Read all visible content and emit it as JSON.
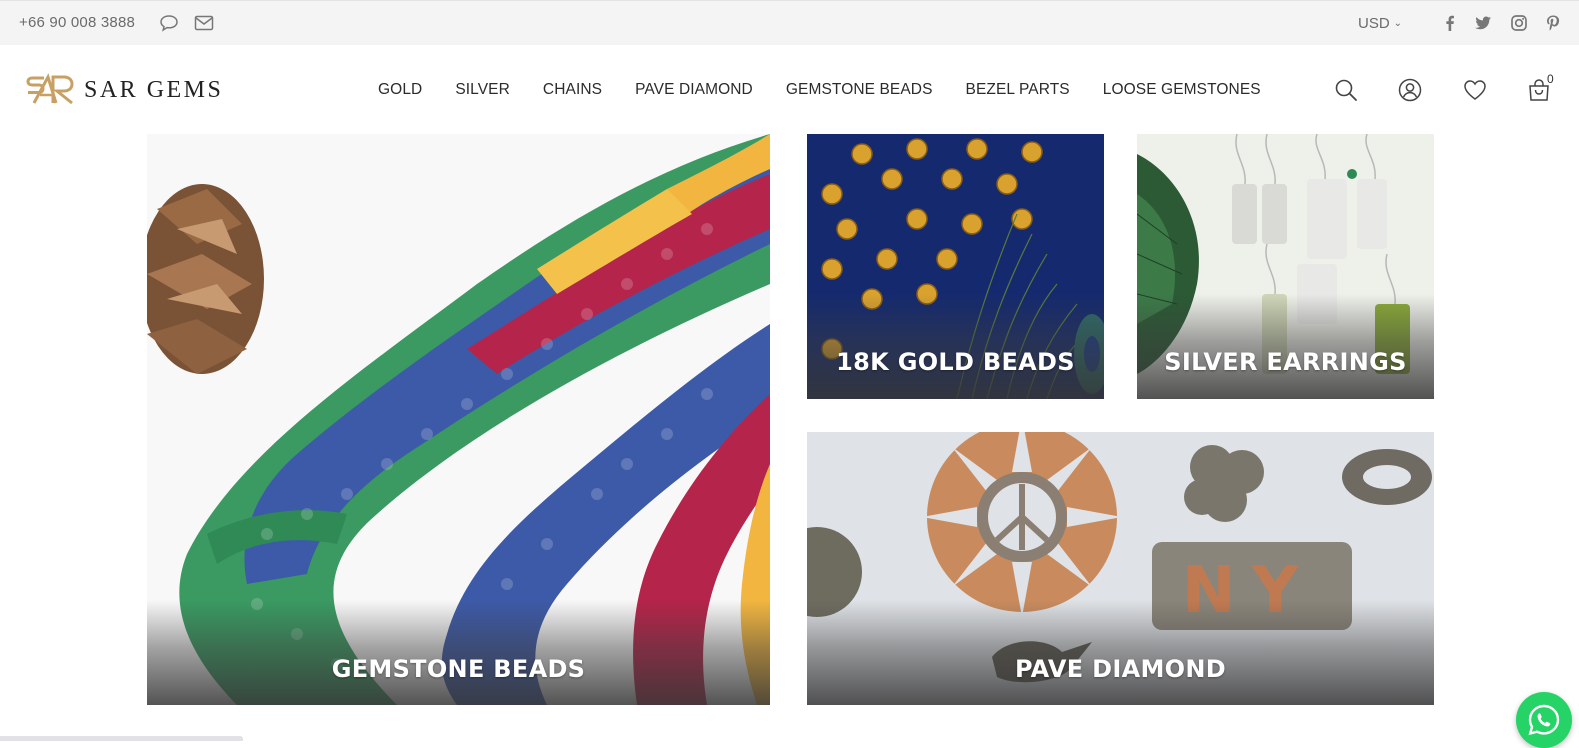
{
  "topbar": {
    "phone": "+66 90 008 3888",
    "currency": "USD",
    "icons": [
      "chat-icon",
      "mail-icon",
      "facebook-icon",
      "twitter-icon",
      "instagram-icon",
      "pinterest-icon"
    ]
  },
  "header": {
    "brand": "SAR GEMS",
    "nav": [
      "GOLD",
      "SILVER",
      "CHAINS",
      "PAVE DIAMOND",
      "GEMSTONE BEADS",
      "BEZEL PARTS",
      "LOOSE GEMSTONES"
    ],
    "cart_count": "0",
    "icons": [
      "search-icon",
      "account-icon",
      "wishlist-icon",
      "cart-icon"
    ]
  },
  "banners": {
    "gemstone_beads": "GEMSTONE BEADS",
    "gold_beads": "18K GOLD BEADS",
    "silver_earrings": "SILVER EARRINGS",
    "pave_diamond": "PAVE DIAMOND"
  },
  "colors": {
    "topbar_bg": "#f4f4f5",
    "brand_gold": "#c9a063",
    "whatsapp": "#25d366"
  }
}
